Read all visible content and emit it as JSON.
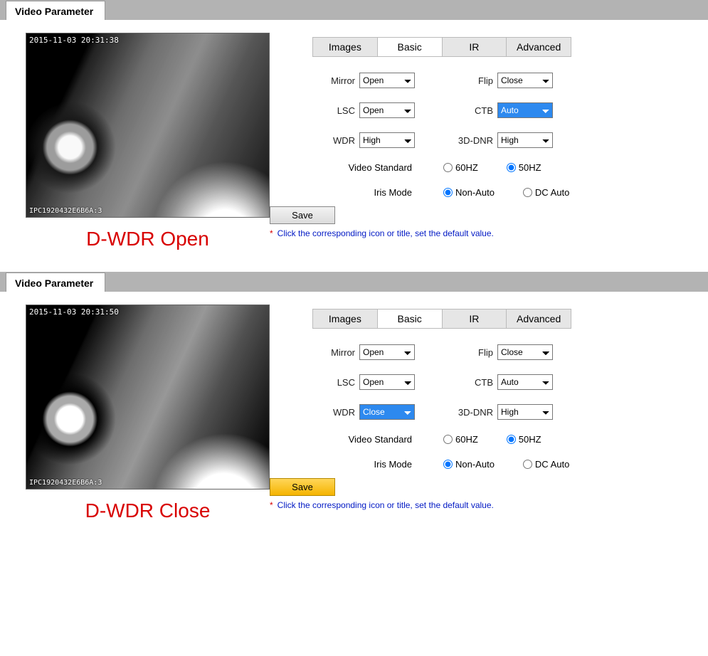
{
  "sections": [
    {
      "tabTitle": "Video Parameter",
      "timestamp": "2015-11-03 20:31:38",
      "osd": "IPC1920432E6B6A:3",
      "caption": "D-WDR Open",
      "tabs": {
        "images": "Images",
        "basic": "Basic",
        "ir": "IR",
        "advanced": "Advanced"
      },
      "labels": {
        "mirror": "Mirror",
        "flip": "Flip",
        "lsc": "LSC",
        "ctb": "CTB",
        "wdr": "WDR",
        "dnr": "3D-DNR",
        "videoStd": "Video Standard",
        "iris": "Iris Mode"
      },
      "values": {
        "mirror": "Open",
        "flip": "Close",
        "lsc": "Open",
        "ctb": "Auto",
        "wdr": "High",
        "dnr": "High"
      },
      "highlight": "ctb",
      "radios": {
        "videoStd": {
          "opt60": "60HZ",
          "opt50": "50HZ",
          "selected": "50"
        },
        "iris": {
          "optNon": "Non-Auto",
          "optDc": "DC Auto",
          "selected": "non"
        }
      },
      "saveLabel": "Save",
      "saveStyle": "plain",
      "hintStar": "*",
      "hint": "Click the corresponding icon or title, set the default value."
    },
    {
      "tabTitle": "Video Parameter",
      "timestamp": "2015-11-03 20:31:50",
      "osd": "IPC1920432E6B6A:3",
      "caption": "D-WDR Close",
      "tabs": {
        "images": "Images",
        "basic": "Basic",
        "ir": "IR",
        "advanced": "Advanced"
      },
      "labels": {
        "mirror": "Mirror",
        "flip": "Flip",
        "lsc": "LSC",
        "ctb": "CTB",
        "wdr": "WDR",
        "dnr": "3D-DNR",
        "videoStd": "Video Standard",
        "iris": "Iris Mode"
      },
      "values": {
        "mirror": "Open",
        "flip": "Close",
        "lsc": "Open",
        "ctb": "Auto",
        "wdr": "Close",
        "dnr": "High"
      },
      "highlight": "wdr",
      "radios": {
        "videoStd": {
          "opt60": "60HZ",
          "opt50": "50HZ",
          "selected": "50"
        },
        "iris": {
          "optNon": "Non-Auto",
          "optDc": "DC Auto",
          "selected": "non"
        }
      },
      "saveLabel": "Save",
      "saveStyle": "amber",
      "hintStar": "*",
      "hint": "Click the corresponding icon or title, set the default value."
    }
  ]
}
